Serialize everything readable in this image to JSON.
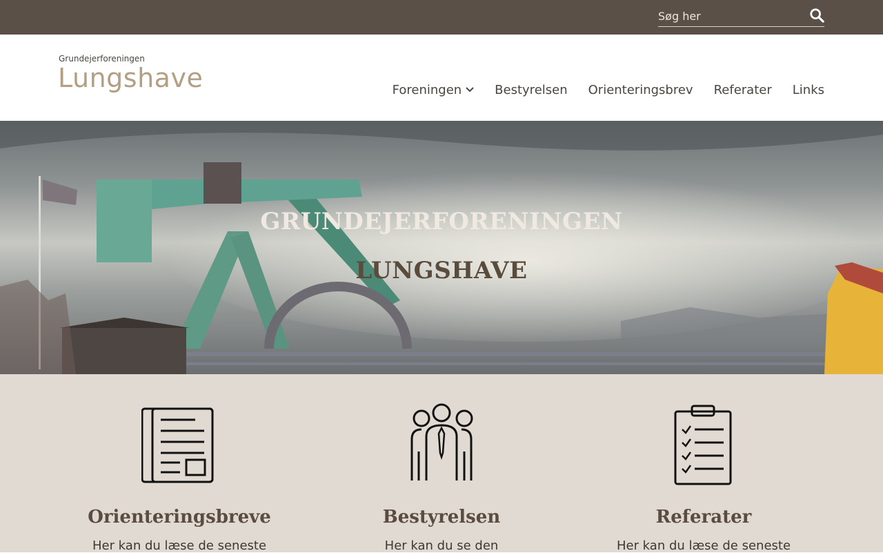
{
  "search": {
    "placeholder": "Søg her",
    "icon": "search-icon"
  },
  "logo": {
    "small": "Grundejerforeningen",
    "big": "Lungshave"
  },
  "nav": {
    "items": [
      {
        "label": "Foreningen",
        "has_dropdown": true
      },
      {
        "label": "Bestyrelsen"
      },
      {
        "label": "Orienteringsbrev"
      },
      {
        "label": "Referater"
      },
      {
        "label": "Links"
      }
    ]
  },
  "hero": {
    "title_line1": "GRUNDEJERFORENINGEN",
    "title_line2": "LUNGSHAVE"
  },
  "features": [
    {
      "icon": "newspaper-icon",
      "title": "Orienteringsbreve",
      "text": "Her kan du læse de seneste"
    },
    {
      "icon": "people-icon",
      "title": "Bestyrelsen",
      "text": "Her kan du se den"
    },
    {
      "icon": "clipboard-checklist-icon",
      "title": "Referater",
      "text": "Her kan du læse de seneste"
    }
  ],
  "colors": {
    "topbar": "#5a5048",
    "logo_accent": "#b39f83",
    "features_bg": "#e1dad3",
    "hero_title_light": "#efe9e1",
    "hero_title_dark": "#5a4c3d"
  }
}
